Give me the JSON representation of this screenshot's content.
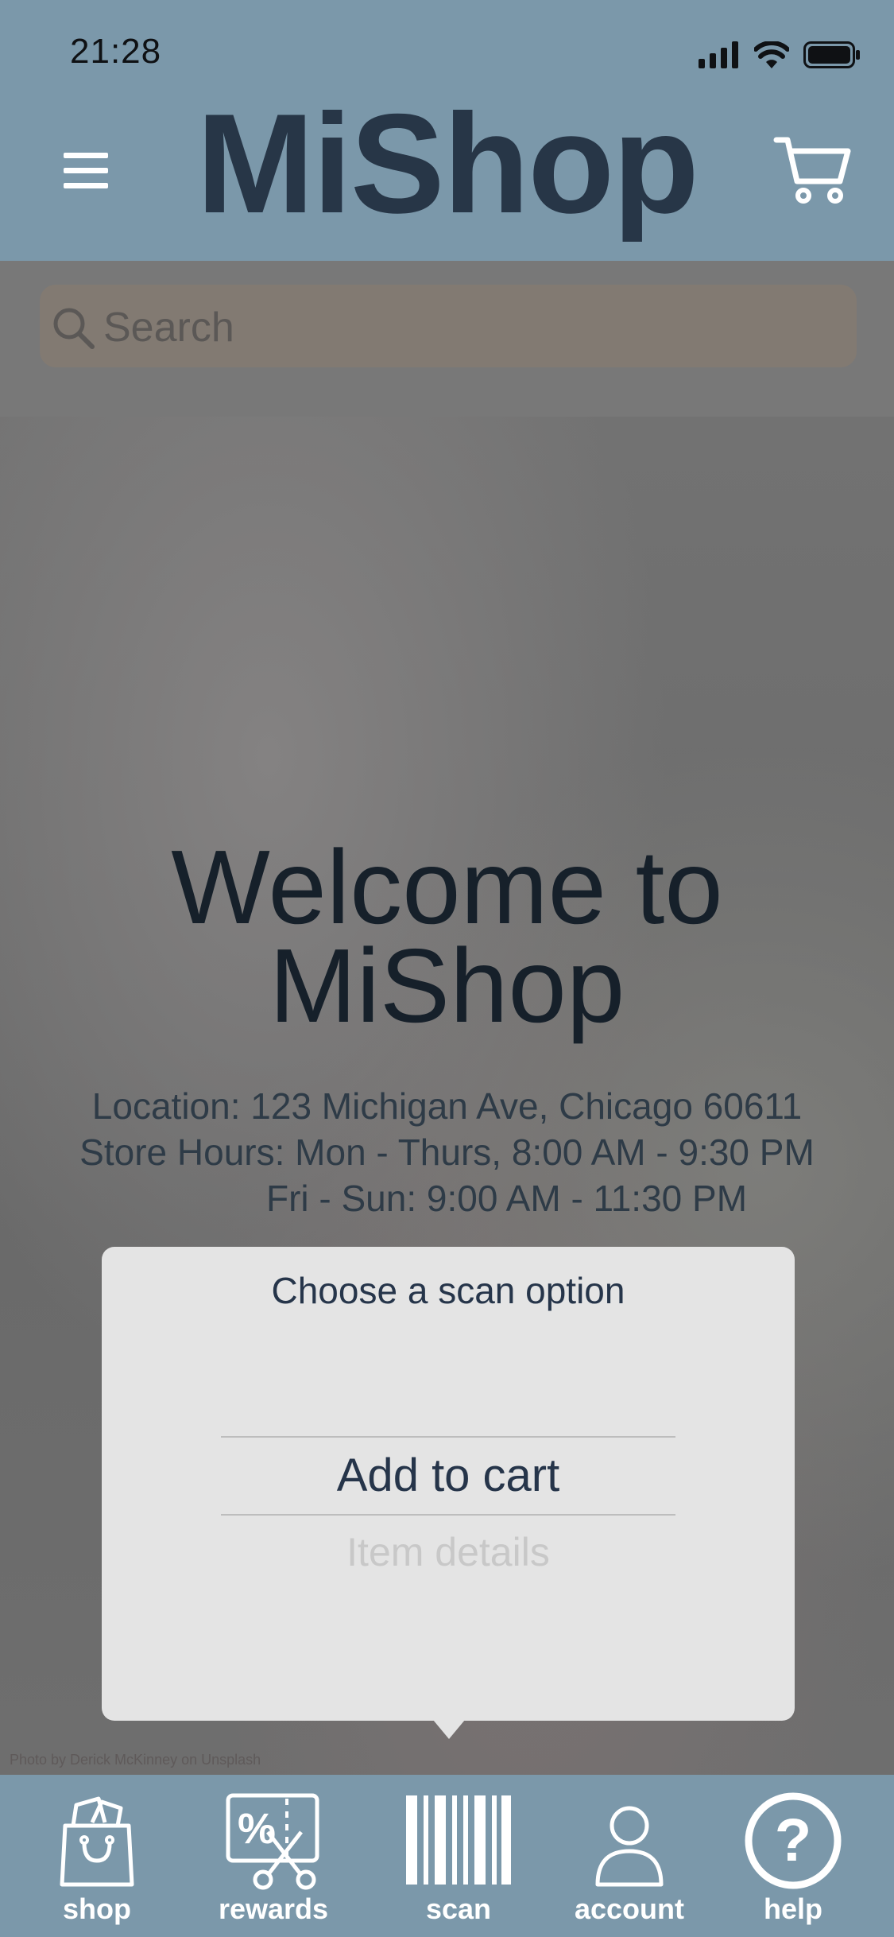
{
  "status_bar": {
    "time": "21:28"
  },
  "header": {
    "brand": "MiShop",
    "color": "#273647"
  },
  "search": {
    "placeholder": "Search"
  },
  "hero": {
    "welcome_line1": "Welcome to",
    "welcome_line2": "MiShop",
    "location": "Location: 123 Michigan Ave, Chicago 60611",
    "hours_line1": "Store Hours: Mon - Thurs, 8:00 AM - 9:30 PM",
    "hours_line2": "Fri - Sun: 9:00 AM - 11:30 PM",
    "photo_credit": "Photo by Derick McKinney on Unsplash"
  },
  "scan_popover": {
    "title": "Choose a scan option",
    "options": [
      {
        "label": "Add to cart",
        "state": "selected"
      },
      {
        "label": "Item details",
        "state": "dimmed"
      }
    ]
  },
  "tabbar": {
    "tabs": [
      {
        "label": "shop",
        "icon": "shopping-bag-icon"
      },
      {
        "label": "rewards",
        "icon": "coupon-scissors-icon"
      },
      {
        "label": "scan",
        "icon": "barcode-icon"
      },
      {
        "label": "account",
        "icon": "person-icon"
      },
      {
        "label": "help",
        "icon": "question-circle-icon"
      }
    ]
  },
  "colors": {
    "bar_background": "#7b98aa",
    "popover_background": "#e4e4e4",
    "accent_text": "#26354a"
  }
}
